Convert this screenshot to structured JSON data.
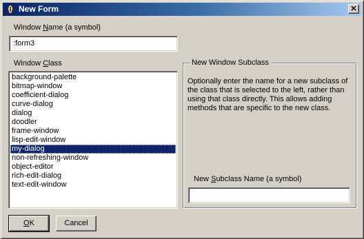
{
  "window": {
    "title": "New Form",
    "title_icon": "lisp-lamp-icon",
    "close_glyph": "✕"
  },
  "window_name": {
    "label_before": "Window ",
    "label_mnemonic": "N",
    "label_after": "ame (a symbol)",
    "value": ":form3"
  },
  "window_class": {
    "label_before": "Window ",
    "label_mnemonic": "C",
    "label_after": "lass",
    "items": [
      "background-palette",
      "bitmap-window",
      "coefficient-dialog",
      "curve-dialog",
      "dialog",
      "doodler",
      "frame-window",
      "lisp-edit-window",
      "my-dialog",
      "non-refreshing-window",
      "object-editor",
      "rich-edit-dialog",
      "text-edit-window"
    ],
    "selected": "my-dialog"
  },
  "subclass": {
    "group_title": "New Window Subclass",
    "description": "Optionally enter the name for a new subclass of the class that is selected to the left, rather than using that class directly.  This allows adding methods that are specific to the new class.",
    "name_label_before": "New ",
    "name_label_mnemonic": "S",
    "name_label_after": "ubclass Name (a symbol)",
    "name_value": ""
  },
  "buttons": {
    "ok_mnemonic": "O",
    "ok_after": "K",
    "cancel_label": "Cancel"
  }
}
